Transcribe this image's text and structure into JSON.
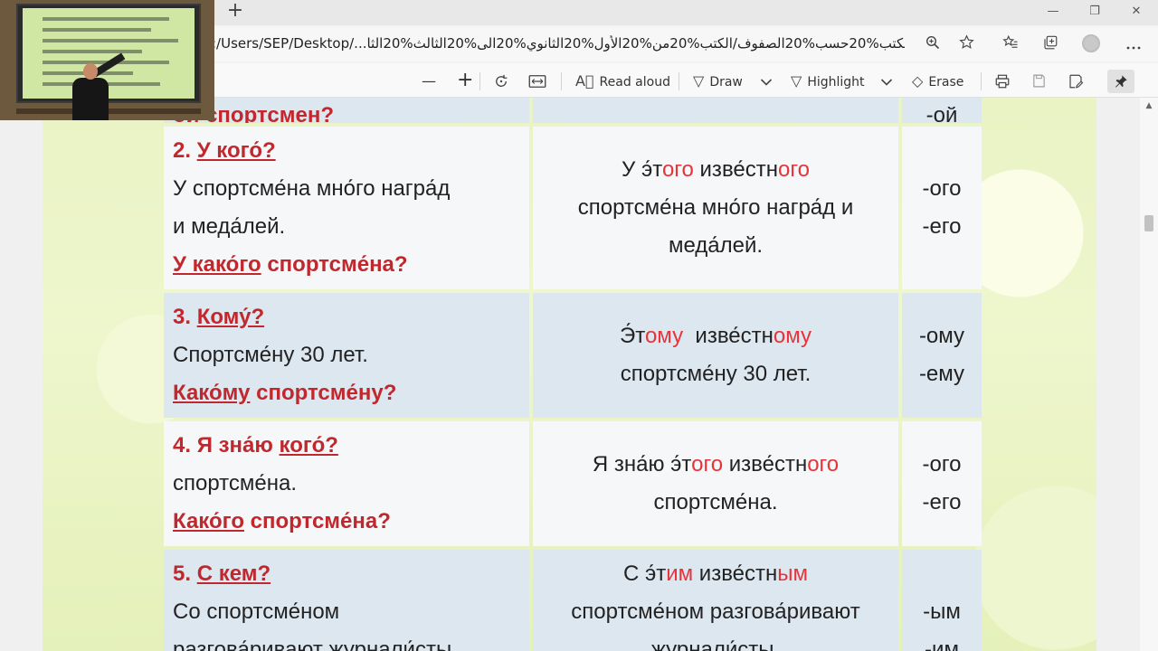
{
  "browser": {
    "new_tab": "+",
    "window_controls": {
      "minimize": "—",
      "restore": "❐",
      "close": "✕"
    },
    "url": ":/Users/SEP/Desktop/...الكتب%20حسب%20الصفوف/الكتب%20من%20الأول%20الثانوي%20الى%20الثالث%20الثا",
    "address_icons": [
      "zoom-icon",
      "favorite-star-icon",
      "favorites-list-icon",
      "collections-icon",
      "profile-avatar",
      "more-menu-icon"
    ]
  },
  "pdf_toolbar": {
    "zoom_out": "—",
    "zoom_in": "+",
    "read_aloud": "Read aloud",
    "draw": "Draw",
    "highlight": "Highlight",
    "erase": "Erase"
  },
  "table": {
    "top_partial": {
      "question": "ой спортсмен?",
      "ending": "-ой"
    },
    "rows": [
      {
        "num": "2.",
        "question": "У кого́?",
        "sentence": [
          "У спортсме́на мно́го  награ́д",
          "и меда́лей."
        ],
        "q2a": "У како́го",
        "q2b": "спортсме́на?",
        "answer": [
          [
            "У э́т",
            "ого",
            " изве́стн",
            "ого"
          ],
          [
            "спортсме́на мно́го награ́д и"
          ],
          [
            "меда́лей."
          ]
        ],
        "endings": [
          "-ого",
          "-его"
        ]
      },
      {
        "num": "3.",
        "question": "Кому́?",
        "sentence": [
          "Спортсме́ну 30 лет."
        ],
        "q2a": "Како́му",
        "q2b": "спортсме́ну?",
        "answer": [
          [
            "Э́т",
            "ому",
            "  изве́стн",
            "ому"
          ],
          [
            "спортсме́ну 30 лет."
          ]
        ],
        "endings": [
          "-ому",
          "-ему"
        ]
      },
      {
        "num": "4.",
        "question_a": "Я зна́ю",
        "question": "кого́?",
        "sentence": [
          "спортсме́на."
        ],
        "q2a": "Како́го",
        "q2b": "спортсме́на?",
        "answer": [
          [
            "Я зна́ю э́т",
            "ого",
            " изве́стн",
            "ого"
          ],
          [
            "спортсме́на."
          ]
        ],
        "endings": [
          "-ого",
          "-его"
        ]
      },
      {
        "num": "5.",
        "question": "С кем?",
        "sentence": [
          "Со спортсме́ном",
          "разгова́ривают журнали́сты."
        ],
        "answer": [
          [
            "С э́т",
            "им",
            " изве́стн",
            "ым"
          ],
          [
            "спортсме́ном разгова́ривают"
          ],
          [
            "журнали́сты."
          ]
        ],
        "endings": [
          "-ым",
          "-им"
        ]
      }
    ]
  }
}
